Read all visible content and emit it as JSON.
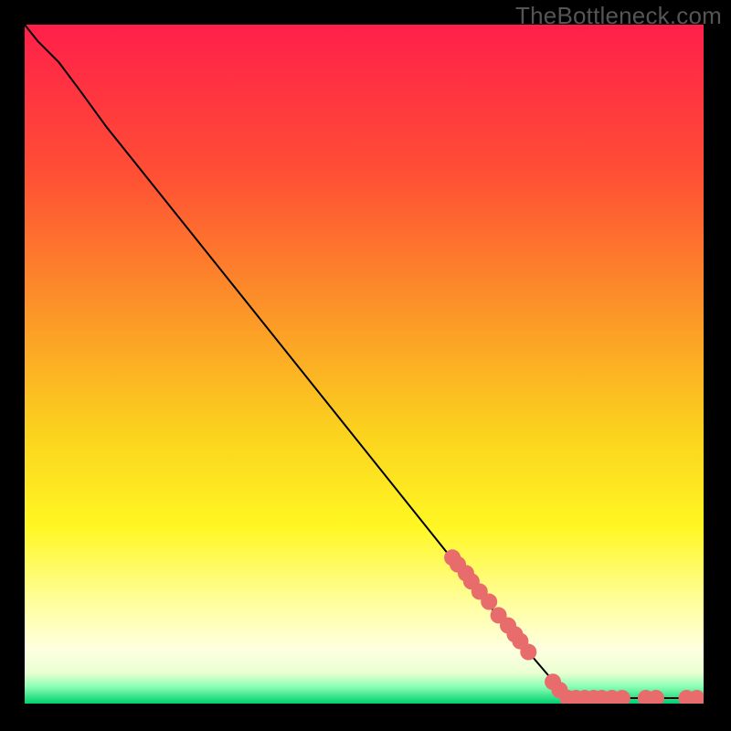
{
  "watermark": "TheBottleneck.com",
  "chart_data": {
    "type": "line",
    "title": "",
    "xlabel": "",
    "ylabel": "",
    "xlim": [
      0,
      100
    ],
    "ylim": [
      0,
      100
    ],
    "background_gradient": {
      "stops": [
        {
          "t": 0.0,
          "color": "#ff1f4a"
        },
        {
          "t": 0.22,
          "color": "#ff4f35"
        },
        {
          "t": 0.42,
          "color": "#fc9428"
        },
        {
          "t": 0.6,
          "color": "#fbd21e"
        },
        {
          "t": 0.74,
          "color": "#fff723"
        },
        {
          "t": 0.86,
          "color": "#ffffa6"
        },
        {
          "t": 0.92,
          "color": "#ffffe0"
        },
        {
          "t": 0.955,
          "color": "#e9ffd2"
        },
        {
          "t": 0.975,
          "color": "#8cffb4"
        },
        {
          "t": 1.0,
          "color": "#00d070"
        }
      ]
    },
    "series": [
      {
        "name": "curve",
        "type": "line",
        "data": [
          {
            "x": 0.0,
            "y": 100.0
          },
          {
            "x": 2.0,
            "y": 97.5
          },
          {
            "x": 5.0,
            "y": 94.5
          },
          {
            "x": 8.0,
            "y": 90.5
          },
          {
            "x": 12.0,
            "y": 85.0
          },
          {
            "x": 20.0,
            "y": 75.0
          },
          {
            "x": 30.0,
            "y": 62.5
          },
          {
            "x": 40.0,
            "y": 50.0
          },
          {
            "x": 50.0,
            "y": 37.5
          },
          {
            "x": 60.0,
            "y": 25.0
          },
          {
            "x": 70.0,
            "y": 12.5
          },
          {
            "x": 80.0,
            "y": 0.8
          },
          {
            "x": 100.0,
            "y": 0.8
          }
        ]
      },
      {
        "name": "markers",
        "type": "scatter",
        "marker_color": "#e86c6c",
        "marker_radius_px": 9,
        "data": [
          {
            "x": 63.0,
            "y": 21.5
          },
          {
            "x": 63.8,
            "y": 20.5
          },
          {
            "x": 65.0,
            "y": 19.2
          },
          {
            "x": 65.8,
            "y": 18.0
          },
          {
            "x": 67.0,
            "y": 16.5
          },
          {
            "x": 68.4,
            "y": 15.0
          },
          {
            "x": 69.8,
            "y": 13.0
          },
          {
            "x": 71.2,
            "y": 11.5
          },
          {
            "x": 72.2,
            "y": 10.2
          },
          {
            "x": 73.0,
            "y": 9.2
          },
          {
            "x": 74.2,
            "y": 7.6
          },
          {
            "x": 77.8,
            "y": 3.2
          },
          {
            "x": 78.8,
            "y": 2.0
          },
          {
            "x": 80.0,
            "y": 0.8
          },
          {
            "x": 81.2,
            "y": 0.8
          },
          {
            "x": 82.5,
            "y": 0.8
          },
          {
            "x": 83.8,
            "y": 0.8
          },
          {
            "x": 85.0,
            "y": 0.8
          },
          {
            "x": 86.5,
            "y": 0.8
          },
          {
            "x": 88.0,
            "y": 0.8
          },
          {
            "x": 91.5,
            "y": 0.8
          },
          {
            "x": 93.0,
            "y": 0.8
          },
          {
            "x": 97.5,
            "y": 0.8
          },
          {
            "x": 99.0,
            "y": 0.8
          }
        ]
      }
    ]
  }
}
